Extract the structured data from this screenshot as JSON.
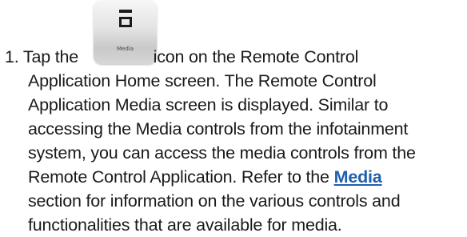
{
  "step": {
    "number": "1.",
    "lines": [
      [
        "Tap the",
        "icon on the Remote Control"
      ],
      [
        "Application Home screen. The Remote Control"
      ],
      [
        "Application Media screen is displayed. Similar to"
      ],
      [
        "accessing the Media controls from the infotainment"
      ],
      [
        "system, you can access the media controls from the"
      ],
      [
        "Remote Control Application. Refer to the",
        "Media",
        ""
      ],
      [
        "section for information on the various controls and"
      ],
      [
        "functionalities that are available for media."
      ]
    ]
  },
  "icon": {
    "name": "media-icon",
    "label": "Media"
  },
  "link": {
    "text": "Media"
  }
}
